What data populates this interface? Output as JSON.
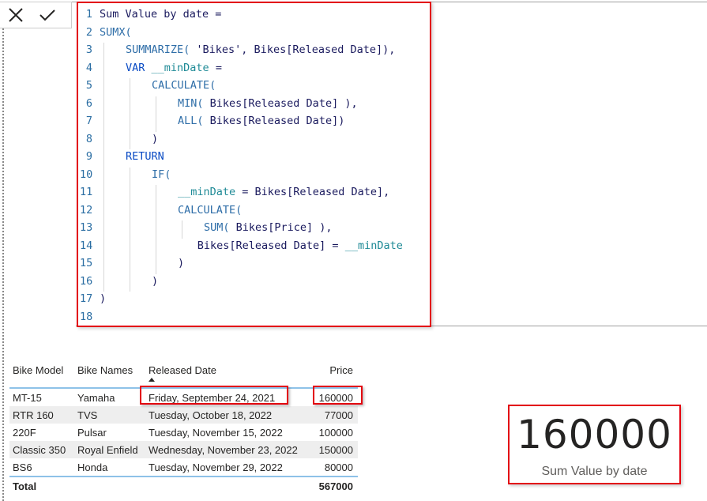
{
  "formula_bar": {
    "cancel_icon": "x-icon",
    "commit_icon": "check-icon",
    "lines": [
      {
        "n": "1",
        "indent": 0,
        "tokens": [
          {
            "t": "Sum Value by date =",
            "c": "str"
          }
        ]
      },
      {
        "n": "2",
        "indent": 0,
        "tokens": [
          {
            "t": "SUMX(",
            "c": "fn"
          }
        ]
      },
      {
        "n": "3",
        "indent": 1,
        "tokens": [
          {
            "t": "SUMMARIZE(",
            "c": "fn"
          },
          {
            "t": " 'Bikes', Bikes[Released Date]),",
            "c": "str"
          }
        ]
      },
      {
        "n": "4",
        "indent": 1,
        "tokens": [
          {
            "t": "VAR",
            "c": "kw"
          },
          {
            "t": " ",
            "c": "str"
          },
          {
            "t": "__minDate",
            "c": "var"
          },
          {
            "t": " =",
            "c": "str"
          }
        ]
      },
      {
        "n": "5",
        "indent": 2,
        "tokens": [
          {
            "t": "CALCULATE(",
            "c": "fn"
          }
        ]
      },
      {
        "n": "6",
        "indent": 3,
        "tokens": [
          {
            "t": "MIN(",
            "c": "fn"
          },
          {
            "t": " Bikes[Released Date] ),",
            "c": "str"
          }
        ]
      },
      {
        "n": "7",
        "indent": 3,
        "tokens": [
          {
            "t": "ALL(",
            "c": "fn"
          },
          {
            "t": " Bikes[Released Date])",
            "c": "str"
          }
        ]
      },
      {
        "n": "8",
        "indent": 2,
        "tokens": [
          {
            "t": ")",
            "c": "str"
          }
        ]
      },
      {
        "n": "9",
        "indent": 1,
        "tokens": [
          {
            "t": "RETURN",
            "c": "kw"
          }
        ]
      },
      {
        "n": "10",
        "indent": 2,
        "tokens": [
          {
            "t": "IF(",
            "c": "fn"
          }
        ]
      },
      {
        "n": "11",
        "indent": 3,
        "tokens": [
          {
            "t": "__minDate",
            "c": "var"
          },
          {
            "t": " = Bikes[Released Date],",
            "c": "str"
          }
        ]
      },
      {
        "n": "12",
        "indent": 3,
        "tokens": [
          {
            "t": "CALCULATE(",
            "c": "fn"
          }
        ]
      },
      {
        "n": "13",
        "indent": 4,
        "tokens": [
          {
            "t": "SUM(",
            "c": "fn"
          },
          {
            "t": " Bikes[Price] ),",
            "c": "str"
          }
        ]
      },
      {
        "n": "14",
        "indent": 3.75,
        "tokens": [
          {
            "t": "Bikes[Released Date] = ",
            "c": "str"
          },
          {
            "t": "__minDate",
            "c": "var"
          }
        ]
      },
      {
        "n": "15",
        "indent": 3,
        "tokens": [
          {
            "t": ")",
            "c": "str"
          }
        ]
      },
      {
        "n": "16",
        "indent": 2,
        "tokens": [
          {
            "t": ")",
            "c": "str"
          }
        ]
      },
      {
        "n": "17",
        "indent": 0,
        "tokens": [
          {
            "t": ")",
            "c": "str"
          }
        ]
      },
      {
        "n": "18",
        "indent": 0,
        "tokens": []
      }
    ]
  },
  "table": {
    "headers": [
      "Bike Model",
      "Bike Names",
      "Released Date",
      "Price"
    ],
    "sorted_column": "Released Date",
    "sort_direction": "ascending",
    "rows": [
      [
        "MT-15",
        "Yamaha",
        "Friday, September 24, 2021",
        "160000"
      ],
      [
        "RTR 160",
        "TVS",
        "Tuesday, October 18, 2022",
        "77000"
      ],
      [
        "220F",
        "Pulsar",
        "Tuesday, November 15, 2022",
        "100000"
      ],
      [
        "Classic 350",
        "Royal Enfield",
        "Wednesday, November 23, 2022",
        "150000"
      ],
      [
        "BS6",
        "Honda",
        "Tuesday, November 29, 2022",
        "80000"
      ]
    ],
    "total_label": "Total",
    "total_value": "567000"
  },
  "card": {
    "value": "160000",
    "label": "Sum Value by date"
  },
  "colors": {
    "highlight": "#e3000f",
    "header_rule": "#8ec2e8",
    "keyword": "#0a4bc4",
    "function": "#2f6ea8",
    "variable": "#1e8a96"
  }
}
